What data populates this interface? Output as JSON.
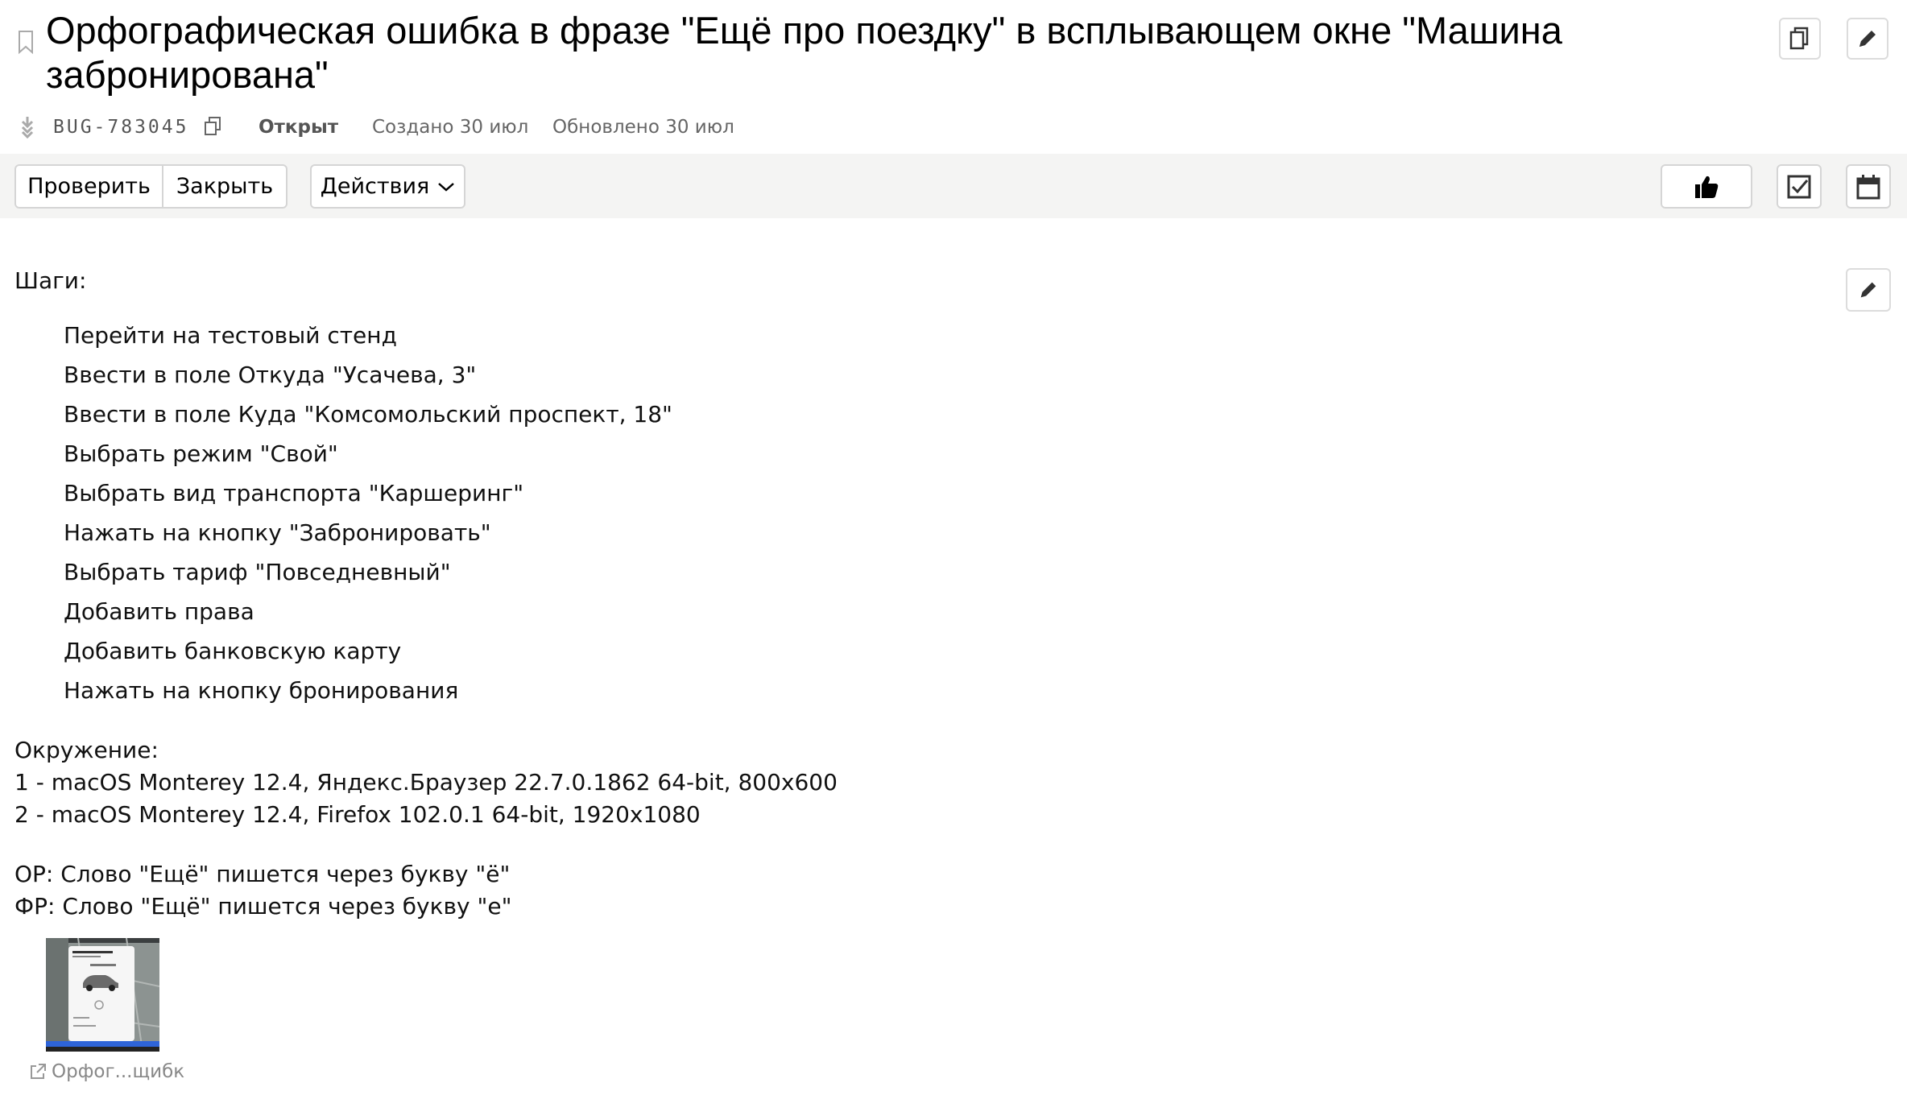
{
  "issue": {
    "title": "Орфографическая ошибка в фразе \"Ещё про поездку\" в всплывающем окне \"Машина забронирована\"",
    "key": "BUG-783045",
    "status": "Открыт",
    "created": "Создано 30 июл",
    "updated": "Обновлено 30 июл"
  },
  "icons": {
    "bookmark": "bookmark-icon",
    "type": "bug-type-icon",
    "copy_key": "copy-icon",
    "copy_issue": "copy-document-icon",
    "edit": "pencil-icon",
    "like": "thumbs-up-icon",
    "checklist": "checkbox-icon",
    "calendar": "calendar-icon",
    "chevron": "chevron-down-icon",
    "external": "external-link-icon"
  },
  "toolbar": {
    "check_label": "Проверить",
    "close_label": "Закрыть",
    "actions_label": "Действия"
  },
  "description": {
    "steps_title": "Шаги:",
    "steps": [
      "Перейти на тестовый стенд",
      "Ввести в поле Откуда \"Усачева, 3\"",
      "Ввести в поле Куда \"Комсомольский проспект, 18\"",
      "Выбрать режим \"Свой\"",
      "Выбрать вид транспорта \"Каршеринг\"",
      "Нажать на кнопку \"Забронировать\"",
      "Выбрать тариф \"Повседневный\"",
      "Добавить права",
      "Добавить банковскую карту",
      "Нажать на кнопку бронирования"
    ],
    "env_title": "Окружение:",
    "env": [
      "1 - macOS Monterey 12.4, Яндекс.Браузер 22.7.0.1862 64-bit, 800х600",
      "2 - macOS Monterey 12.4, Firefox 102.0.1 64-bit, 1920x1080"
    ],
    "expected": "ОР: Слово \"Ещё\" пишется через букву \"ё\"",
    "actual": "ФР: Слово \"Ещё\" пишется через букву \"е\""
  },
  "attachment": {
    "name": "Орфог...щибк"
  },
  "colors": {
    "toolbar_bg": "#f4f4f3",
    "border": "#d5d5d5",
    "muted_text": "#666666"
  }
}
